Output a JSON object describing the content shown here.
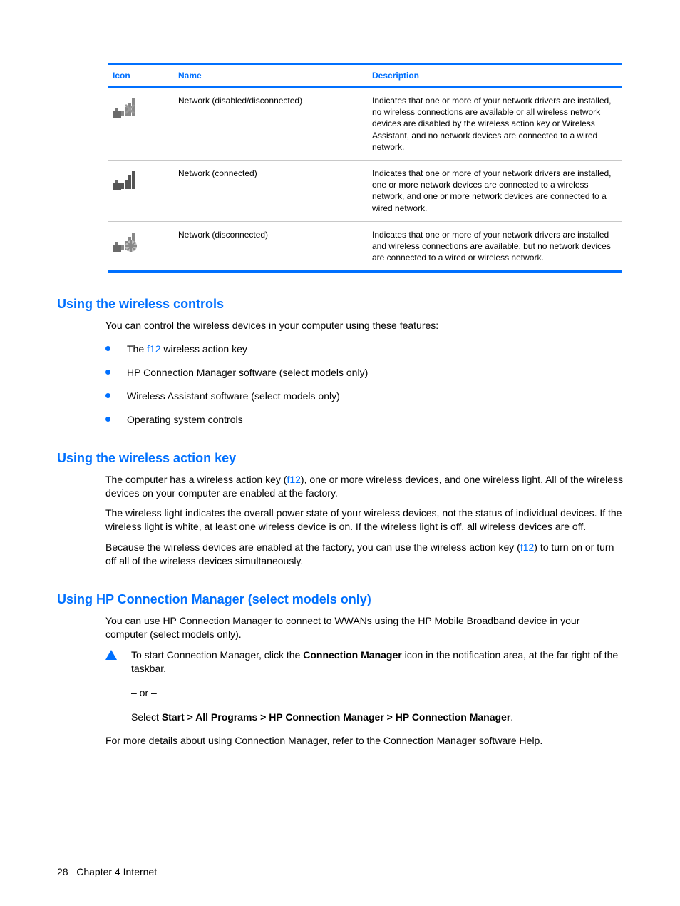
{
  "table": {
    "headers": {
      "icon": "Icon",
      "name": "Name",
      "desc": "Description"
    },
    "rows": [
      {
        "name": "Network (disabled/disconnected)",
        "desc": "Indicates that one or more of your network drivers are installed, no wireless connections are available or all wireless network devices are disabled by the wireless action key or Wireless Assistant, and no network devices are connected to a wired network."
      },
      {
        "name": "Network (connected)",
        "desc": "Indicates that one or more of your network drivers are installed, one or more network devices are connected to a wireless network, and one or more network devices are connected to a wired network."
      },
      {
        "name": "Network (disconnected)",
        "desc": "Indicates that one or more of your network drivers are installed and wireless connections are available, but no network devices are connected to a wired or wireless network."
      }
    ]
  },
  "sections": {
    "wireless_controls": {
      "heading": "Using the wireless controls",
      "intro": "You can control the wireless devices in your computer using these features:",
      "bullets_pre1": "The ",
      "bullets_key1": "f12",
      "bullets_post1": " wireless action key",
      "bullet2": "HP Connection Manager software (select models only)",
      "bullet3": "Wireless Assistant software (select models only)",
      "bullet4": "Operating system controls"
    },
    "action_key": {
      "heading": "Using the wireless action key",
      "p1a": "The computer has a wireless action key (",
      "p1key": "f12",
      "p1b": "), one or more wireless devices, and one wireless light. All of the wireless devices on your computer are enabled at the factory.",
      "p2": "The wireless light indicates the overall power state of your wireless devices, not the status of individual devices. If the wireless light is white, at least one wireless device is on. If the wireless light is off, all wireless devices are off.",
      "p3a": "Because the wireless devices are enabled at the factory, you can use the wireless action key (",
      "p3key": "f12",
      "p3b": ") to turn on or turn off all of the wireless devices simultaneously."
    },
    "conn_mgr": {
      "heading": "Using HP Connection Manager (select models only)",
      "p1": "You can use HP Connection Manager to connect to WWANs using the HP Mobile Broadband device in your computer (select models only).",
      "note1a": "To start Connection Manager, click the ",
      "note1bold": "Connection Manager",
      "note1b": " icon in the notification area, at the far right of the taskbar.",
      "or": "– or –",
      "note2a": "Select ",
      "note2bold": "Start > All Programs > HP Connection Manager > HP Connection Manager",
      "note2b": ".",
      "p2": "For more details about using Connection Manager, refer to the Connection Manager software Help."
    }
  },
  "footer": {
    "page": "28",
    "chapter": "Chapter 4   Internet"
  }
}
